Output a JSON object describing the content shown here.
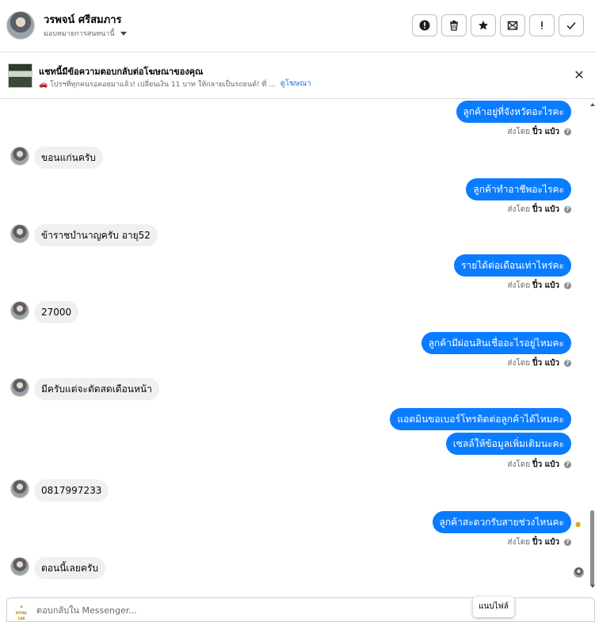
{
  "header": {
    "user_name": "วรพจน์ ศรีสมภาร",
    "assign_label": "มอบหมายการสนทนานี้",
    "actions": [
      {
        "icon": "alert-circle-icon",
        "name": "mark-spam-button"
      },
      {
        "icon": "trash-icon",
        "name": "delete-button"
      },
      {
        "icon": "star-icon",
        "name": "star-button"
      },
      {
        "icon": "mail-icon",
        "name": "mark-unread-button"
      },
      {
        "icon": "exclamation-icon",
        "name": "follow-up-button"
      },
      {
        "icon": "check-icon",
        "name": "mark-done-button"
      }
    ]
  },
  "ad": {
    "title": "แชทนี้มีข้อความตอบกลับต่อโฆษณาของคุณ",
    "description": "🚗 โปรฯที่ทุกคนรอคอยมาแล้ว! เปลี่ยนเงิน 11 บาท ให้กลายเป็นรถยนต์! ที่ ...",
    "see_ad": "ดูโฆษณา"
  },
  "messages": [
    {
      "dir": "out",
      "text": "ลูกค้าอยู่ที่จังหวัดอะไรคะ"
    },
    {
      "dir": "sent_by",
      "prefix": "ส่งโดย",
      "sender": "ปิ๋ว แป๋ว"
    },
    {
      "dir": "in",
      "text": "ขอนแก่นครับ"
    },
    {
      "dir": "out",
      "text": "ลูกค้าทำอาชีพอะไรคะ"
    },
    {
      "dir": "sent_by",
      "prefix": "ส่งโดย",
      "sender": "ปิ๋ว แป๋ว"
    },
    {
      "dir": "in",
      "text": "ข้าราชบำนาญครับ อายุ52"
    },
    {
      "dir": "out",
      "text": "รายได้ต่อเดือนเท่าไหร่คะ"
    },
    {
      "dir": "sent_by",
      "prefix": "ส่งโดย",
      "sender": "ปิ๋ว แป๋ว"
    },
    {
      "dir": "in",
      "text": "27000"
    },
    {
      "dir": "out",
      "text": "ลูกค้ามีผ่อนสินเชื่ออะไรอยู่ไหมคะ"
    },
    {
      "dir": "sent_by",
      "prefix": "ส่งโดย",
      "sender": "ปิ๋ว แป๋ว"
    },
    {
      "dir": "in",
      "text": "มีครับแต่จะตัดสดเดือนหน้า"
    },
    {
      "dir": "out",
      "text": "แอดมินขอเบอร์โทรติดต่อลูกค้าได้ไหมคะ"
    },
    {
      "dir": "out",
      "text": "เซลล์ให้ข้อมูลเพิ่มเติมนะคะ"
    },
    {
      "dir": "sent_by",
      "prefix": "ส่งโดย",
      "sender": "ปิ๋ว แป๋ว"
    },
    {
      "dir": "in",
      "text": "0817997233"
    },
    {
      "dir": "out",
      "text": "ลูกค้าสะดวกรับสายช่วงไหนคะ"
    },
    {
      "dir": "sent_by",
      "prefix": "ส่งโดย",
      "sender": "ปิ๋ว แป๋ว"
    },
    {
      "dir": "in",
      "text": "ตอนนี้เลยครับ"
    }
  ],
  "composer": {
    "placeholder": "ตอบกลับใน Messenger...",
    "logo_text": "ROYAL CAR"
  },
  "tooltip": "แนบไฟล์"
}
